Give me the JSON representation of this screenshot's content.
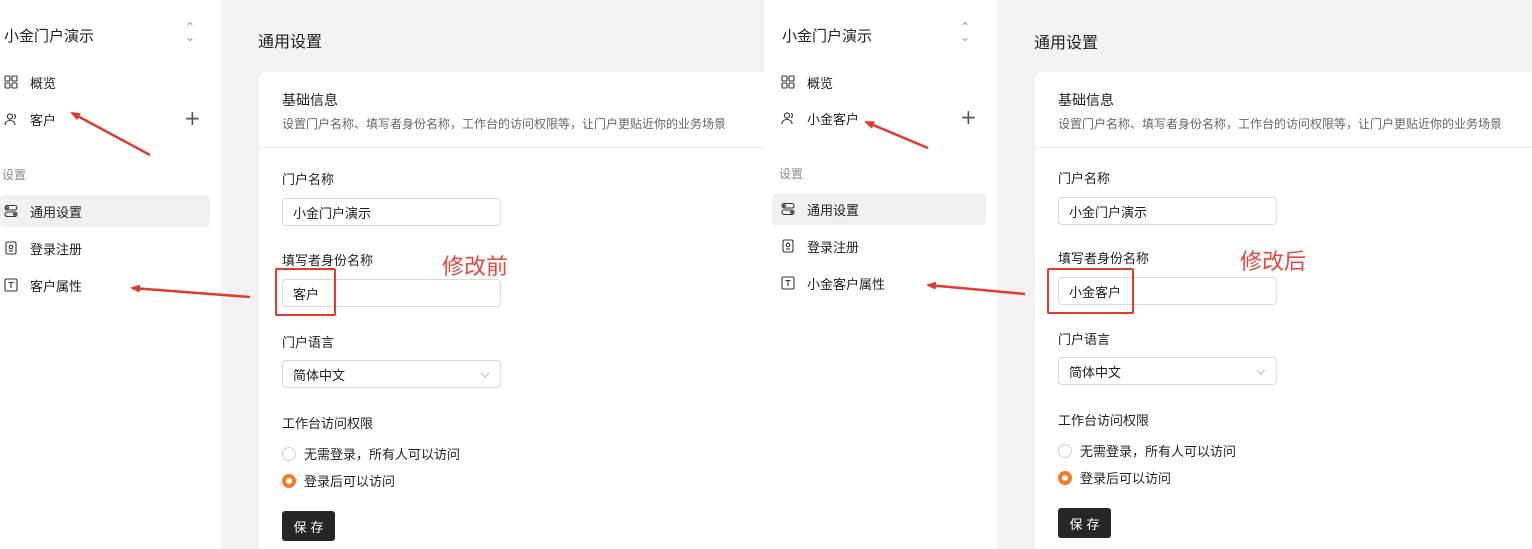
{
  "colors": {
    "accent": "#f27d26",
    "annotation": "#e8463c",
    "save_bg": "#262626"
  },
  "before": {
    "sidebar": {
      "app_name": "小金门户演示",
      "switch_icon": "chevron-up-down-icon",
      "nav": [
        {
          "label": "概览",
          "icon": "grid-icon"
        },
        {
          "label": "客户",
          "icon": "user-icon"
        }
      ],
      "section_label": "设置",
      "settings": [
        {
          "label": "通用设置",
          "icon": "toggle-settings-icon"
        },
        {
          "label": "登录注册",
          "icon": "badge-icon"
        },
        {
          "label": "客户属性",
          "icon": "text-t-icon"
        }
      ]
    },
    "main": {
      "page_title": "通用设置",
      "card_title": "基础信息",
      "card_desc": "设置门户名称、填写者身份名称，工作台的访问权限等，让门户更贴近你的业务场景",
      "portal_name_label": "门户名称",
      "portal_name_value": "小金门户演示",
      "identity_label": "填写者身份名称",
      "identity_value": "客户",
      "language_label": "门户语言",
      "language_value": "简体中文",
      "access_label": "工作台访问权限",
      "access_options": [
        "无需登录，所有人可以访问",
        "登录后可以访问"
      ],
      "save_label": "保存"
    },
    "annotation": "修改前"
  },
  "after": {
    "sidebar": {
      "app_name": "小金门户演示",
      "switch_icon": "chevron-up-down-icon",
      "nav": [
        {
          "label": "概览",
          "icon": "grid-icon"
        },
        {
          "label": "小金客户",
          "icon": "user-icon"
        }
      ],
      "section_label": "设置",
      "settings": [
        {
          "label": "通用设置",
          "icon": "toggle-settings-icon"
        },
        {
          "label": "登录注册",
          "icon": "badge-icon"
        },
        {
          "label": "小金客户属性",
          "icon": "text-t-icon"
        }
      ]
    },
    "main": {
      "page_title": "通用设置",
      "card_title": "基础信息",
      "card_desc": "设置门户名称、填写者身份名称，工作台的访问权限等，让门户更贴近你的业务场景",
      "portal_name_label": "门户名称",
      "portal_name_value": "小金门户演示",
      "identity_label": "填写者身份名称",
      "identity_value": "小金客户",
      "language_label": "门户语言",
      "language_value": "简体中文",
      "access_label": "工作台访问权限",
      "access_options": [
        "无需登录，所有人可以访问",
        "登录后可以访问"
      ],
      "save_label": "保存"
    },
    "annotation": "修改后"
  }
}
